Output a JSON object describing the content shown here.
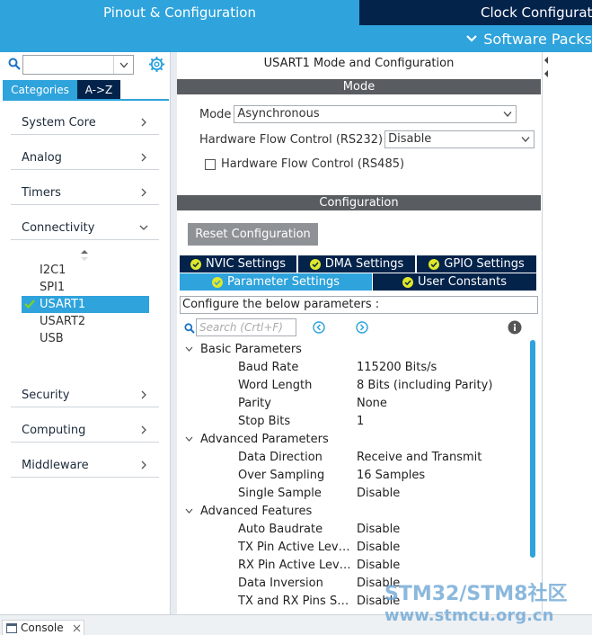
{
  "top_tabs": {
    "pinout": "Pinout & Configuration",
    "clock": "Clock Configuration"
  },
  "software_packs": "Software Packs",
  "left": {
    "search": {
      "value": ""
    },
    "tabs": [
      "Categories",
      "A->Z"
    ],
    "categories": [
      "System Core",
      "Analog",
      "Timers",
      "Connectivity",
      "Security",
      "Computing",
      "Middleware"
    ],
    "connectivity_items": [
      "I2C1",
      "SPI1",
      "USART1",
      "USART2",
      "USB"
    ],
    "selected_item": "USART1"
  },
  "right": {
    "title": "USART1 Mode and Configuration",
    "mode_header": "Mode",
    "mode": {
      "label": "Mode",
      "value": "Asynchronous"
    },
    "hw_flow": {
      "label": "Hardware Flow Control (RS232)",
      "value": "Disable"
    },
    "rs485": {
      "label": "Hardware Flow Control (RS485)",
      "checked": false
    },
    "config_header": "Configuration",
    "reset_button": "Reset Configuration",
    "tabs": [
      "NVIC Settings",
      "DMA Settings",
      "GPIO Settings",
      "Parameter Settings",
      "User Constants"
    ],
    "active_tab": "Parameter Settings",
    "configure_text": "Configure the below parameters :",
    "search_placeholder": "Search (Crtl+F)",
    "groups": [
      {
        "name": "Basic Parameters",
        "params": [
          {
            "name": "Baud Rate",
            "value": "115200 Bits/s"
          },
          {
            "name": "Word Length",
            "value": "8 Bits (including Parity)"
          },
          {
            "name": "Parity",
            "value": "None"
          },
          {
            "name": "Stop Bits",
            "value": "1"
          }
        ]
      },
      {
        "name": "Advanced Parameters",
        "params": [
          {
            "name": "Data Direction",
            "value": "Receive and Transmit"
          },
          {
            "name": "Over Sampling",
            "value": "16 Samples"
          },
          {
            "name": "Single Sample",
            "value": "Disable"
          }
        ]
      },
      {
        "name": "Advanced Features",
        "params": [
          {
            "name": "Auto Baudrate",
            "value": "Disable"
          },
          {
            "name": "TX Pin Active Level I...",
            "value": "Disable"
          },
          {
            "name": "RX Pin Active Level ...",
            "value": "Disable"
          },
          {
            "name": "Data Inversion",
            "value": "Disable"
          },
          {
            "name": "TX and RX Pins Sw...",
            "value": "Disable"
          }
        ]
      }
    ]
  },
  "console": {
    "label": "Console"
  },
  "watermark": {
    "line1": "STM32/STM8社区",
    "line2": "www.stmcu.org.cn"
  },
  "colors": {
    "accent": "#2ea3dc",
    "navy": "#03234b",
    "header_gray": "#595d61"
  }
}
